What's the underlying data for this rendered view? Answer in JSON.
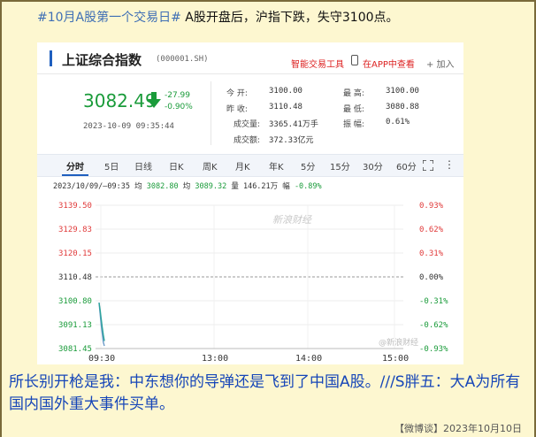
{
  "headline": {
    "hashtag": "#10月A股第一个交易日#",
    "text": " A股开盘后，沪指下跌，失守3100点。"
  },
  "quote": {
    "index_name": "上证综合指数",
    "index_code": "(000001.SH)",
    "smart_trading": "智能交易工具",
    "app_view": "在APP中查看",
    "add": "+ 加入",
    "price": "3082.49",
    "change": "-27.99",
    "change_pct": "-0.90%",
    "datetime": "2023-10-09 09:35:44",
    "stats": [
      {
        "label": "今    开:",
        "value": "3100.00"
      },
      {
        "label": "最    高:",
        "value": "3100.00"
      },
      {
        "label": "昨    收:",
        "value": "3110.48"
      },
      {
        "label": "最    低:",
        "value": "3080.88"
      },
      {
        "label": "成交量:",
        "value": "3365.41万手"
      },
      {
        "label": "振    幅:",
        "value": "0.61%"
      },
      {
        "label": "成交额:",
        "value": "372.33亿元"
      }
    ]
  },
  "tabs": [
    "分时",
    "5日",
    "日线",
    "日K",
    "周K",
    "月K",
    "年K",
    "5分",
    "15分",
    "30分",
    "60分"
  ],
  "info_line": {
    "range": "2023/10/09/—09:35",
    "avg_label": "均",
    "avg": "3082.80",
    "price_label": "均",
    "price": "3089.32",
    "vol_label": "量",
    "vol": "146.21万",
    "amp_label": "幅",
    "amp": "-0.89%"
  },
  "watermark": "新浪财经",
  "watermark2": "@新浪财经",
  "chart_data": {
    "type": "line",
    "y_ticks": [
      "3139.50",
      "3129.83",
      "3120.15",
      "3110.48",
      "3100.80",
      "3091.13",
      "3081.45"
    ],
    "y_pct_ticks": [
      "0.93%",
      "0.62%",
      "0.31%",
      "0.00%",
      "-0.31%",
      "-0.62%",
      "-0.93%"
    ],
    "x_ticks": [
      "09:30",
      "13:00",
      "14:00",
      "15:00"
    ],
    "ylim": [
      3081.45,
      3139.5
    ],
    "prev_close": 3110.48,
    "series": [
      {
        "values": [
          3100.0,
          3095.5,
          3091.0,
          3087.5,
          3084.0,
          3082.5
        ]
      },
      {
        "values": [
          3100.0,
          3097.0,
          3093.5,
          3090.0,
          3087.0,
          3084.5
        ]
      }
    ],
    "colors": {
      "price": "#6a9ac8",
      "avg": "#2aa39b",
      "up": "#e03a3a",
      "down": "#1a9b3a"
    }
  },
  "caption": {
    "text": "所长别开枪是我：中东想你的导弹还是飞到了中国A股。///S胖五：大A为所有国内国外重大事件买单。",
    "source": "【微博谈】2023年10月10日"
  }
}
